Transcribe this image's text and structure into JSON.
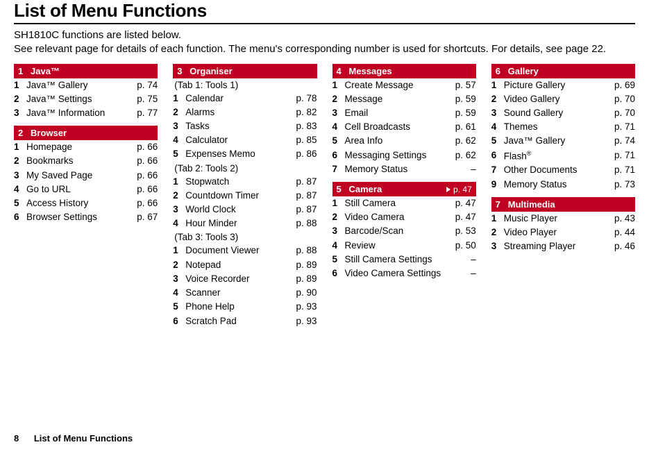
{
  "title": "List of Menu Functions",
  "intro_line1": "SH1810C functions are listed below.",
  "intro_line2": "See relevant page for details of each function. The menu's corresponding number is used for shortcuts. For details, see page 22.",
  "footer": {
    "page_num": "8",
    "label": "List of Menu Functions"
  },
  "sections": {
    "java": {
      "num": "1",
      "name": "Java™",
      "items": [
        {
          "n": "1",
          "label": "Java™ Gallery",
          "page": "p. 74"
        },
        {
          "n": "2",
          "label": "Java™ Settings",
          "page": "p. 75"
        },
        {
          "n": "3",
          "label": "Java™ Information",
          "page": "p. 77"
        }
      ]
    },
    "browser": {
      "num": "2",
      "name": "Browser",
      "items": [
        {
          "n": "1",
          "label": "Homepage",
          "page": "p. 66"
        },
        {
          "n": "2",
          "label": "Bookmarks",
          "page": "p. 66"
        },
        {
          "n": "3",
          "label": "My Saved Page",
          "page": "p. 66"
        },
        {
          "n": "4",
          "label": "Go to URL",
          "page": "p. 66"
        },
        {
          "n": "5",
          "label": "Access History",
          "page": "p. 66"
        },
        {
          "n": "6",
          "label": "Browser Settings",
          "page": "p. 67"
        }
      ]
    },
    "organiser": {
      "num": "3",
      "name": "Organiser",
      "tab1": "(Tab 1: Tools 1)",
      "tab1_items": [
        {
          "n": "1",
          "label": "Calendar",
          "page": "p. 78"
        },
        {
          "n": "2",
          "label": "Alarms",
          "page": "p. 82"
        },
        {
          "n": "3",
          "label": "Tasks",
          "page": "p. 83"
        },
        {
          "n": "4",
          "label": "Calculator",
          "page": "p. 85"
        },
        {
          "n": "5",
          "label": "Expenses Memo",
          "page": "p. 86"
        }
      ],
      "tab2": "(Tab 2: Tools 2)",
      "tab2_items": [
        {
          "n": "1",
          "label": "Stopwatch",
          "page": "p. 87"
        },
        {
          "n": "2",
          "label": "Countdown Timer",
          "page": "p. 87"
        },
        {
          "n": "3",
          "label": "World Clock",
          "page": "p. 87"
        },
        {
          "n": "4",
          "label": "Hour Minder",
          "page": "p. 88"
        }
      ],
      "tab3": "(Tab 3: Tools 3)",
      "tab3_items": [
        {
          "n": "1",
          "label": "Document Viewer",
          "page": "p. 88"
        },
        {
          "n": "2",
          "label": "Notepad",
          "page": "p. 89"
        },
        {
          "n": "3",
          "label": "Voice Recorder",
          "page": "p. 89"
        },
        {
          "n": "4",
          "label": "Scanner",
          "page": "p. 90"
        },
        {
          "n": "5",
          "label": "Phone Help",
          "page": "p. 93"
        },
        {
          "n": "6",
          "label": "Scratch Pad",
          "page": "p. 93"
        }
      ]
    },
    "messages": {
      "num": "4",
      "name": "Messages",
      "items": [
        {
          "n": "1",
          "label": "Create Message",
          "page": "p. 57"
        },
        {
          "n": "2",
          "label": "Message",
          "page": "p. 59"
        },
        {
          "n": "3",
          "label": "Email",
          "page": "p. 59"
        },
        {
          "n": "4",
          "label": "Cell Broadcasts",
          "page": "p. 61"
        },
        {
          "n": "5",
          "label": "Area Info",
          "page": "p. 62"
        },
        {
          "n": "6",
          "label": "Messaging Settings",
          "page": "p. 62"
        },
        {
          "n": "7",
          "label": "Memory Status",
          "page": "–"
        }
      ]
    },
    "camera": {
      "num": "5",
      "name": "Camera",
      "header_page": "p. 47",
      "items": [
        {
          "n": "1",
          "label": "Still Camera",
          "page": "p. 47"
        },
        {
          "n": "2",
          "label": "Video Camera",
          "page": "p. 47"
        },
        {
          "n": "3",
          "label": "Barcode/Scan",
          "page": "p. 53"
        },
        {
          "n": "4",
          "label": "Review",
          "page": "p. 50"
        },
        {
          "n": "5",
          "label": "Still Camera Settings",
          "page": "–"
        },
        {
          "n": "6",
          "label": "Video Camera Settings",
          "page": "–"
        }
      ]
    },
    "gallery": {
      "num": "6",
      "name": "Gallery",
      "items": [
        {
          "n": "1",
          "label": "Picture Gallery",
          "page": "p. 69"
        },
        {
          "n": "2",
          "label": "Video Gallery",
          "page": "p. 70"
        },
        {
          "n": "3",
          "label": "Sound Gallery",
          "page": "p. 70"
        },
        {
          "n": "4",
          "label": "Themes",
          "page": "p. 71"
        },
        {
          "n": "5",
          "label": "Java™ Gallery",
          "page": "p. 74"
        },
        {
          "n": "6",
          "label": "Flash",
          "page": "p. 71",
          "sup": "®"
        },
        {
          "n": "7",
          "label": "Other Documents",
          "page": "p. 71"
        },
        {
          "n": "9",
          "label": "Memory Status",
          "page": "p. 73"
        }
      ]
    },
    "multimedia": {
      "num": "7",
      "name": "Multimedia",
      "items": [
        {
          "n": "1",
          "label": "Music Player",
          "page": "p. 43"
        },
        {
          "n": "2",
          "label": "Video Player",
          "page": "p. 44"
        },
        {
          "n": "3",
          "label": "Streaming Player",
          "page": "p. 46"
        }
      ]
    }
  }
}
